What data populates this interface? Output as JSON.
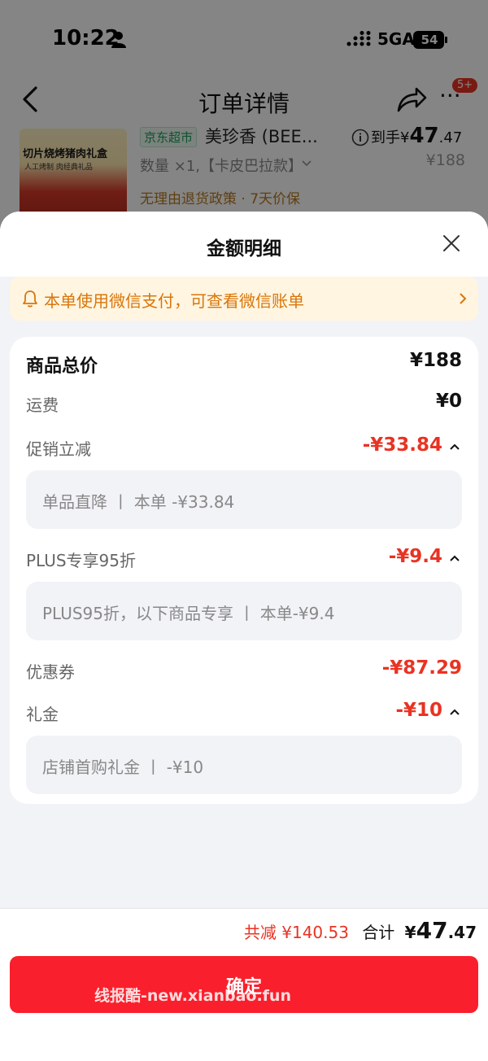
{
  "status_bar": {
    "time": "10:22",
    "network": "5GA",
    "battery": "54"
  },
  "nav": {
    "title": "订单详情",
    "badge": "5+"
  },
  "product": {
    "thumb_title": "切片烧烤猪肉礼盒",
    "thumb_sub": "人工烤制 肉经典礼品",
    "store_tag": "京东超市",
    "name": "美珍香 (BEE...",
    "spec": "数量 ×1,【卡皮巴拉款】",
    "policy": "无理由退货政策 · 7天价保",
    "arrive_label": "到手",
    "arrive_symbol": "¥",
    "arrive_int": "47",
    "arrive_dec": ".47",
    "original_price": "¥188"
  },
  "sheet": {
    "title": "金额明细",
    "notice": "本单使用微信支付，可查看微信账单"
  },
  "details": {
    "goods_total": {
      "label": "商品总价",
      "value": "¥188"
    },
    "shipping": {
      "label": "运费",
      "value": "¥0"
    },
    "promo": {
      "label": "促销立减",
      "value": "-¥33.84",
      "detail": "单品直降 丨 本单 -¥33.84"
    },
    "plus": {
      "label": "PLUS专享95折",
      "value": "-¥9.4",
      "detail": "PLUS95折，以下商品专享 丨 本单-¥9.4"
    },
    "coupon": {
      "label": "优惠券",
      "value": "-¥87.29"
    },
    "gift": {
      "label": "礼金",
      "value": "-¥10",
      "detail": "店铺首购礼金 丨 -¥10"
    }
  },
  "footer": {
    "saved": "共减 ¥140.53",
    "total_label": "合计",
    "total_symbol": "¥",
    "total_int": "47",
    "total_dec": ".47",
    "confirm": "确定",
    "watermark": "线报酷-new.xianbao.fun"
  },
  "colors": {
    "accent": "#fa1f2c",
    "discount": "#e93323",
    "notice": "#d9760b",
    "notice_bg": "#fff5e0"
  }
}
